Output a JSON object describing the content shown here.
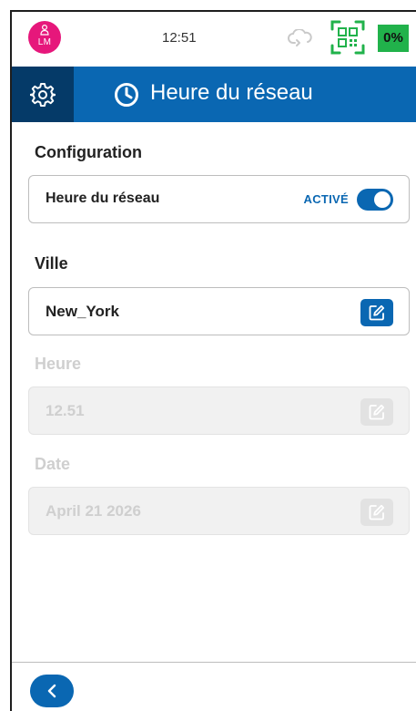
{
  "status_bar": {
    "avatar_initials": "LM",
    "time": "12:51",
    "battery": "0%"
  },
  "header": {
    "title": "Heure du réseau"
  },
  "configuration": {
    "section_label": "Configuration",
    "field_label": "Heure du réseau",
    "toggle_status": "ACTIVÉ",
    "toggle_on": true
  },
  "city": {
    "section_label": "Ville",
    "value": "New_York"
  },
  "time": {
    "section_label": "Heure",
    "value": "12.51"
  },
  "date": {
    "section_label": "Date",
    "value": "April 21 2026"
  },
  "colors": {
    "primary": "#0a67b2",
    "header_dark": "#053a68",
    "avatar": "#e6177b",
    "battery": "#21b24b"
  }
}
